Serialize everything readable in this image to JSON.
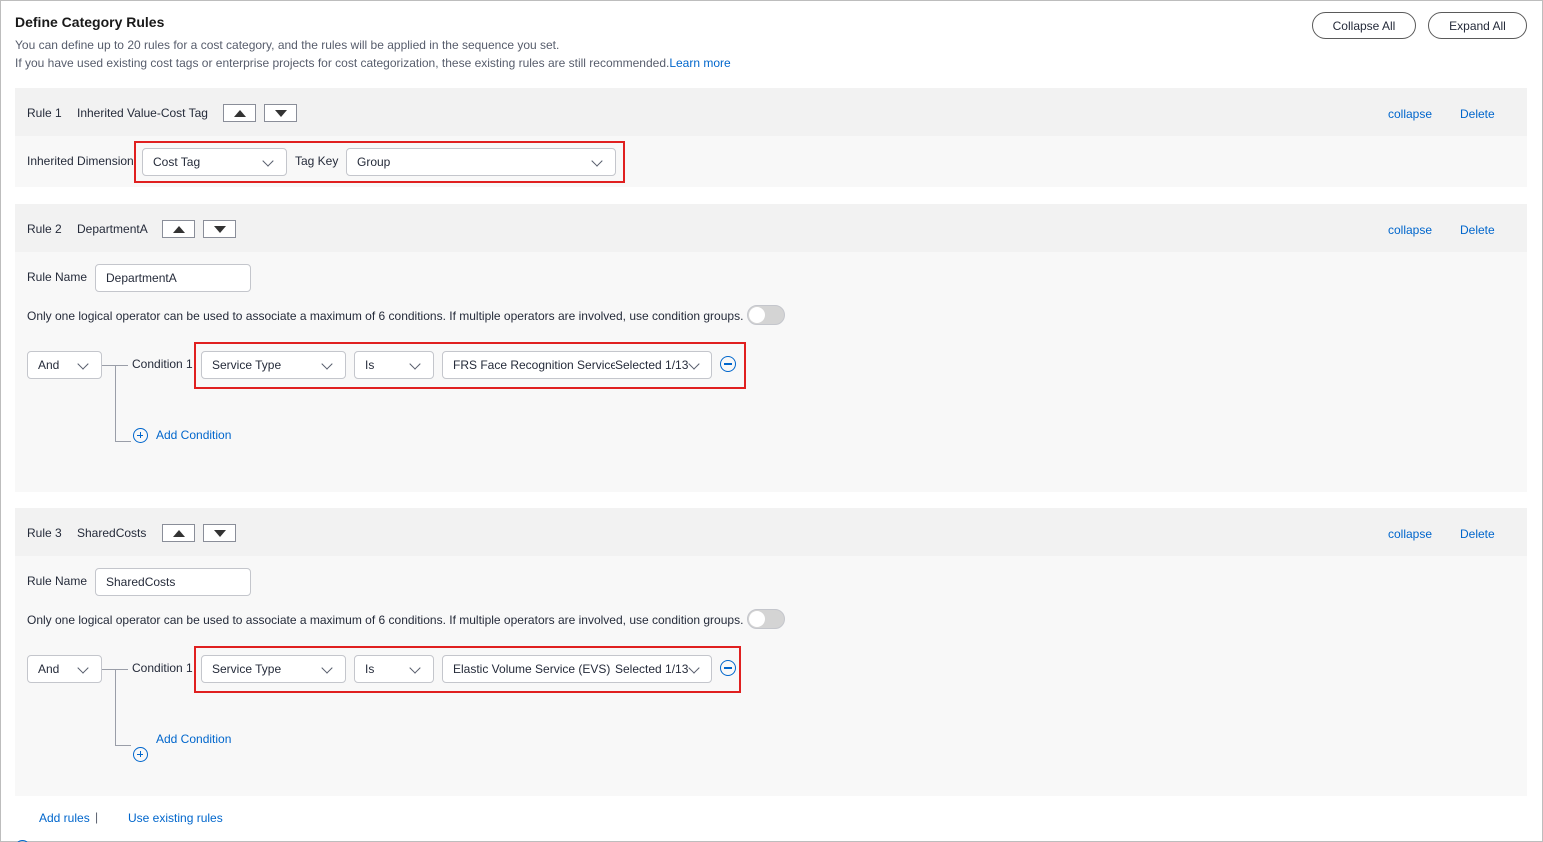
{
  "header": {
    "title": "Define Category Rules",
    "desc1": "You can define up to 20 rules for a cost category, and the rules will be applied in the sequence you set.",
    "desc2": "If you have used existing cost tags or enterprise projects for cost categorization, these existing rules are still recommended.",
    "learn_more": "Learn more",
    "collapse_all": "Collapse All",
    "expand_all": "Expand All"
  },
  "rule1": {
    "label": "Rule 1",
    "name": "Inherited Value-Cost Tag",
    "collapse": "collapse",
    "delete": "Delete",
    "dimension_label": "Inherited Dimension",
    "dimension_value": "Cost Tag",
    "tag_key_label": "Tag Key",
    "tag_key_value": "Group"
  },
  "rule2": {
    "label": "Rule 2",
    "name": "DepartmentA",
    "collapse": "collapse",
    "delete": "Delete",
    "rule_name_label": "Rule Name",
    "rule_name_value": "DepartmentA",
    "operator_note": "Only one logical operator can be used to associate a maximum of 6 conditions. If multiple operators are involved, use condition groups.",
    "logic": "And",
    "condition_label": "Condition 1",
    "field": "Service Type",
    "op": "Is",
    "value": "FRS Face Recognition Service",
    "selected": "Selected 1/13",
    "add_condition": "Add Condition"
  },
  "rule3": {
    "label": "Rule 3",
    "name": "SharedCosts",
    "collapse": "collapse",
    "delete": "Delete",
    "rule_name_label": "Rule Name",
    "rule_name_value": "SharedCosts",
    "operator_note": "Only one logical operator can be used to associate a maximum of 6 conditions. If multiple operators are involved, use condition groups.",
    "logic": "And",
    "condition_label": "Condition 1",
    "field": "Service Type",
    "op": "Is",
    "value": "Elastic Volume Service (EVS)",
    "selected": "Selected 1/13",
    "add_condition": "Add Condition"
  },
  "footer": {
    "add_rules": "Add rules",
    "separator": "|",
    "use_existing": "Use existing rules"
  },
  "colors": {
    "link": "#0066cc",
    "highlight_border": "#e02020",
    "rule_header_bg": "#f2f2f2",
    "rule_body_bg": "#f8f8f8"
  }
}
